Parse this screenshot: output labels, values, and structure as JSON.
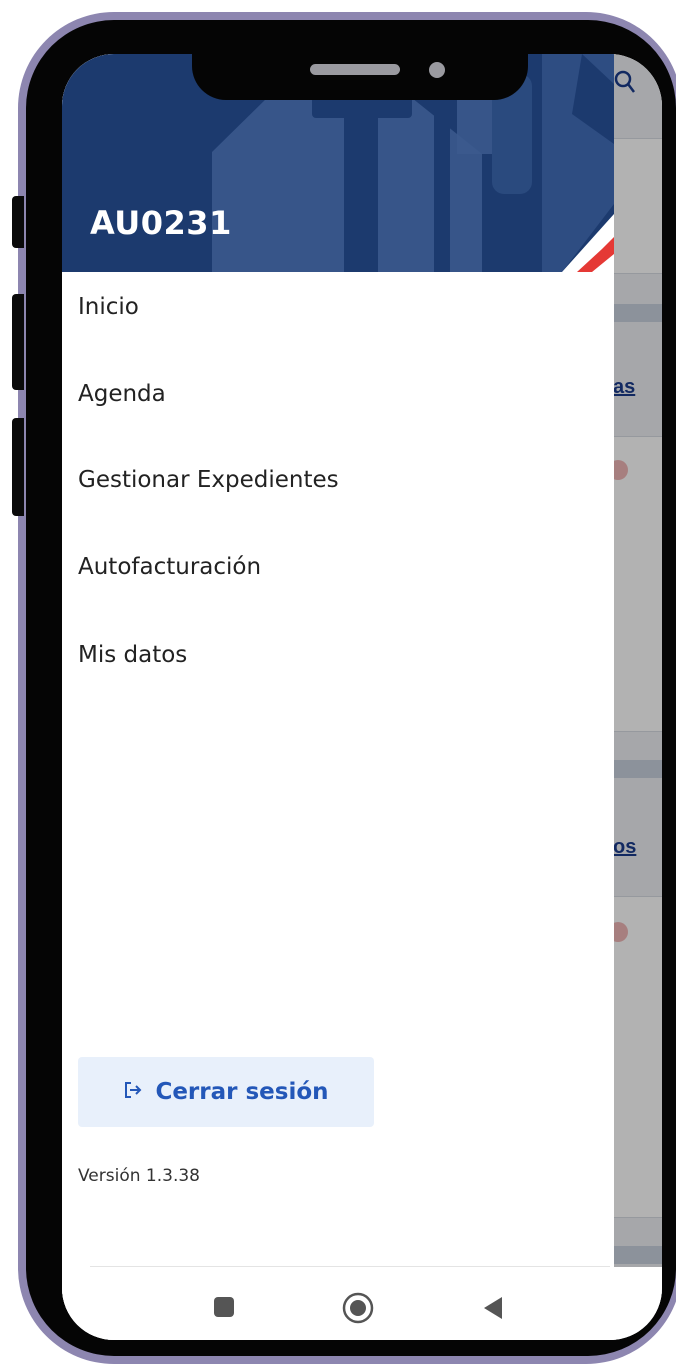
{
  "drawer": {
    "user_code": "AU0231",
    "menu_items": [
      {
        "label": "Inicio"
      },
      {
        "label": "Agenda"
      },
      {
        "label": "Gestionar Expedientes"
      },
      {
        "label": "Autofacturación"
      },
      {
        "label": "Mis datos"
      }
    ],
    "logout": {
      "label": "Cerrar sesión",
      "icon": "logout-icon"
    },
    "version": "Versión 1.3.38"
  },
  "background": {
    "link_1": "as",
    "link_2": "os",
    "search_icon": "search-icon"
  },
  "navbar": {
    "icons": [
      "recent-apps-icon",
      "home-icon",
      "back-icon"
    ]
  },
  "colors": {
    "header_bg": "#1c3a6e",
    "accent": "#2357b8",
    "logout_bg": "#e8f0fb",
    "red_accent": "#e53935"
  }
}
